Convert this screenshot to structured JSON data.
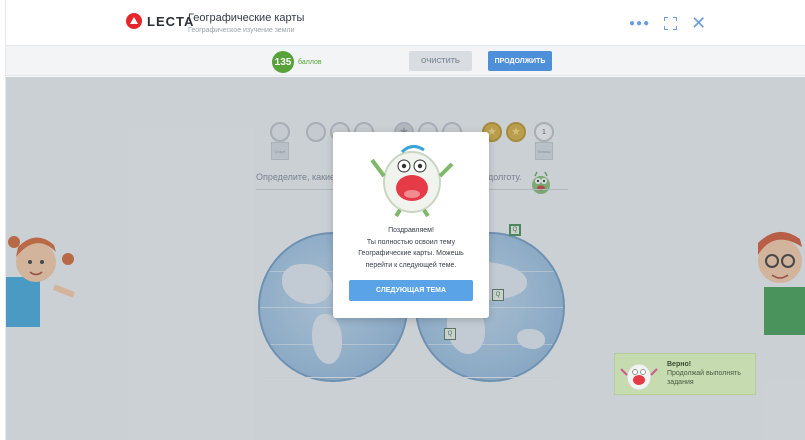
{
  "header": {
    "logo_text": "LECTA",
    "title": "Географические карты",
    "subtitle": "Географическое изучение земли",
    "icons": [
      "more-dots-icon",
      "expand-icon",
      "close-icon"
    ]
  },
  "toolbar": {
    "score_value": "135",
    "score_label": "баллов",
    "clear_label": "ОЧИСТИТЬ",
    "continue_label": "ПРОДОЛЖИТЬ"
  },
  "progress": {
    "start_label": "Старт",
    "finish_number": "1",
    "finish_label": "Финиш"
  },
  "task": {
    "question_left": "Определите, какие",
    "question_right": "долготу."
  },
  "modal": {
    "line1": "Поздравляем!",
    "line2": "Ты полностью освоил тему",
    "line3": "Географические карты. Можешь",
    "line4": "перейти к следующей теме.",
    "button_label": "СЛЕДУЮЩАЯ ТЕМА"
  },
  "toast": {
    "title": "Верно!",
    "text": "Продолжай выполнять задания"
  },
  "colors": {
    "accent_blue": "#4d8fd9",
    "score_green": "#58a23a",
    "brand_red": "#e5262c",
    "toast_green": "#c6dbb0"
  }
}
